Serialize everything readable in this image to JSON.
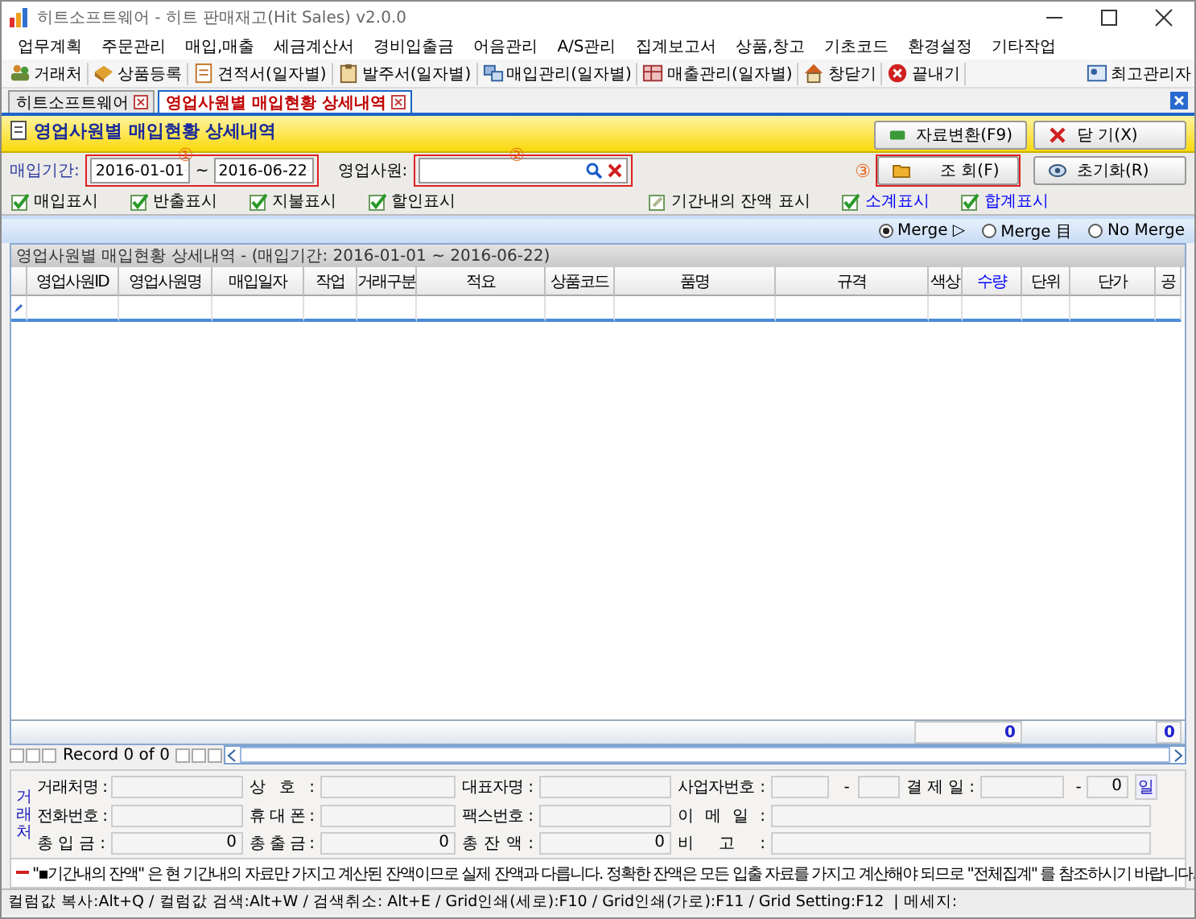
{
  "window": {
    "title": "히트소프트웨어 - 히트 판매재고(Hit Sales) v2.0.0"
  },
  "menu": [
    "업무계획",
    "주문관리",
    "매입,매출",
    "세금계산서",
    "경비입출금",
    "어음관리",
    "A/S관리",
    "집계보고서",
    "상품,창고",
    "기초코드",
    "환경설정",
    "기타작업"
  ],
  "toolbar": {
    "items": [
      "거래처",
      "상품등록",
      "견적서(일자별)",
      "발주서(일자별)",
      "매입관리(일자별)",
      "매출관리(일자별)",
      "창닫기",
      "끝내기"
    ],
    "user": "최고관리자"
  },
  "tabs": [
    {
      "label": "히트소프트웨어",
      "selected": false
    },
    {
      "label": "영업사원별 매입현황 상세내역",
      "selected": true
    }
  ],
  "header": {
    "title": "영업사원별 매입현황 상세내역",
    "buttons": [
      "자료변환(F9)",
      "닫 기(X)"
    ]
  },
  "filter": {
    "period_label": "매입기간:",
    "date_from": "2016-01-01",
    "separator": "~",
    "date_to": "2016-06-22",
    "period_marker": "①",
    "staff_label": "영업사원:",
    "staff_marker": "②",
    "search_button": "조 회(F)",
    "search_marker": "③",
    "reset_button": "초기화(R)"
  },
  "options": [
    {
      "label": "매입표시",
      "checked": true,
      "color": "#000000"
    },
    {
      "label": "반출표시",
      "checked": true,
      "color": "#000000"
    },
    {
      "label": "지불표시",
      "checked": true,
      "color": "#000000"
    },
    {
      "label": "할인표시",
      "checked": true,
      "color": "#000000"
    },
    {
      "label": "기간내의 잔액 표시",
      "checked": false,
      "color": "#000000"
    },
    {
      "label": "소계표시",
      "checked": true,
      "color": "#0000ff"
    },
    {
      "label": "합계표시",
      "checked": true,
      "color": "#0000ff"
    }
  ],
  "merge_modes": [
    {
      "label": "Merge ▷",
      "selected": true
    },
    {
      "label": "Merge 目",
      "selected": false
    },
    {
      "label": "No Merge",
      "selected": false
    }
  ],
  "table": {
    "caption": "영업사원별 매입현황 상세내역 - (매입기간: 2016-01-01 ~ 2016-06-22)",
    "columns": [
      {
        "label": "영업사원ID",
        "color": "#000000"
      },
      {
        "label": "영업사원명",
        "color": "#000000"
      },
      {
        "label": "매입일자",
        "color": "#000000"
      },
      {
        "label": "작업",
        "color": "#000000"
      },
      {
        "label": "거래구분",
        "color": "#000000"
      },
      {
        "label": "적요",
        "color": "#000000"
      },
      {
        "label": "상품코드",
        "color": "#000000"
      },
      {
        "label": "품명",
        "color": "#000000"
      },
      {
        "label": "규격",
        "color": "#000000"
      },
      {
        "label": "색상",
        "color": "#000000"
      },
      {
        "label": "수량",
        "color": "#0000ff"
      },
      {
        "label": "단위",
        "color": "#000000"
      },
      {
        "label": "단가",
        "color": "#000000"
      },
      {
        "label": "공",
        "color": "#000000"
      }
    ],
    "totals": {
      "quantity": "0",
      "column_14": "0"
    },
    "record_info": "Record 0 of 0"
  },
  "customer_panel": {
    "title": "거래처",
    "rows": [
      [
        {
          "kind": "label",
          "text": "거래처명 :"
        },
        {
          "kind": "field"
        },
        {
          "kind": "label",
          "text": "상 호 :"
        },
        {
          "kind": "field"
        },
        {
          "kind": "label",
          "text": "대표자명 :"
        },
        {
          "kind": "field"
        },
        {
          "kind": "label",
          "text": "사업자번호 :"
        },
        {
          "kind": "field"
        },
        {
          "kind": "sep",
          "text": "-"
        },
        {
          "kind": "field"
        },
        {
          "kind": "label",
          "text": "결 제 일 :"
        },
        {
          "kind": "field"
        },
        {
          "kind": "sep",
          "text": "-"
        },
        {
          "kind": "field",
          "value": "0"
        },
        {
          "kind": "unit",
          "text": "일"
        }
      ],
      [
        {
          "kind": "label",
          "text": "전화번호 :"
        },
        {
          "kind": "field"
        },
        {
          "kind": "label",
          "text": "휴 대 폰 :"
        },
        {
          "kind": "field"
        },
        {
          "kind": "label",
          "text": "팩스번호 :"
        },
        {
          "kind": "field"
        },
        {
          "kind": "label",
          "text": "이 메 일 :"
        },
        {
          "kind": "field"
        }
      ],
      [
        {
          "kind": "label",
          "text": "총 입 금 :"
        },
        {
          "kind": "field",
          "value": "0"
        },
        {
          "kind": "label",
          "text": "총 출 금 :"
        },
        {
          "kind": "field",
          "value": "0"
        },
        {
          "kind": "label",
          "text": "총 잔 액 :"
        },
        {
          "kind": "field",
          "value": "0"
        },
        {
          "kind": "label",
          "text": "비 고 :"
        },
        {
          "kind": "field"
        }
      ]
    ]
  },
  "note": "\"▪기간내의 잔액\" 은 현 기간내의 자료만 가지고 계산된 잔액이므로 실제 잔액과 다릅니다.  정확한 잔액은 모든 입출 자료를 가지고 계산해야 되므로 \"전체집계\" 를 참조하시기 바랍니다.",
  "status_bar": {
    "shortcuts": "컬럼값 복사:Alt+Q / 컬럼값 검색:Alt+W / 검색취소: Alt+E / Grid인쇄(세로):F10 / Grid인쇄(가로):F11 / Grid Setting:F12",
    "message_label": "| 메세지:"
  }
}
